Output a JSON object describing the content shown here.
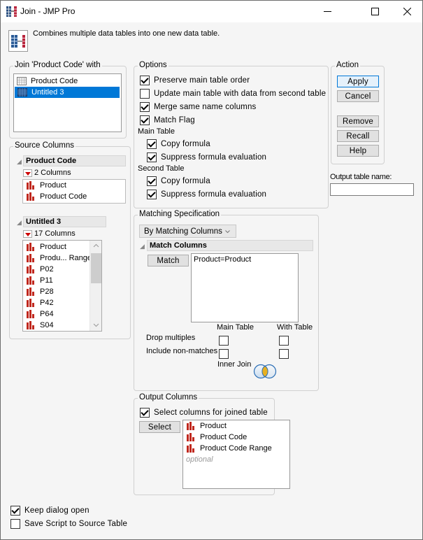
{
  "window": {
    "title": "Join - JMP Pro",
    "minimize_icon": "minimize-icon",
    "maximize_icon": "maximize-icon",
    "close_icon": "close-icon"
  },
  "header": {
    "description": "Combines multiple data tables into one new data table.",
    "app_icon": "join-tables-icon"
  },
  "join_with": {
    "label": "Join 'Product Code' with",
    "tables": [
      {
        "name": "Product Code",
        "selected": false,
        "icon": "data-table-icon"
      },
      {
        "name": "Untitled 3",
        "selected": true,
        "icon": "data-table-icon"
      }
    ]
  },
  "source_columns": {
    "label": "Source Columns",
    "tables": [
      {
        "name": "Product Code",
        "count_label": "2 Columns",
        "columns": [
          "Product",
          "Product Code"
        ]
      },
      {
        "name": "Untitled 3",
        "count_label": "17 Columns",
        "columns": [
          "Product",
          "Produ... Range",
          "P02",
          "P11",
          "P28",
          "P42",
          "P64",
          "S04"
        ]
      }
    ]
  },
  "options": {
    "label": "Options",
    "items": [
      {
        "label": "Preserve main table order",
        "checked": true
      },
      {
        "label": "Update main table with data from second table",
        "checked": false
      },
      {
        "label": "Merge same name columns",
        "checked": true
      },
      {
        "label": "Match Flag",
        "checked": true
      }
    ],
    "main_table": {
      "label": "Main Table",
      "items": [
        {
          "label": "Copy formula",
          "checked": true
        },
        {
          "label": "Suppress formula evaluation",
          "checked": true
        }
      ]
    },
    "second_table": {
      "label": "Second Table",
      "items": [
        {
          "label": "Copy formula",
          "checked": true
        },
        {
          "label": "Suppress formula evaluation",
          "checked": true
        }
      ]
    }
  },
  "action": {
    "label": "Action",
    "apply": "Apply",
    "cancel": "Cancel",
    "remove": "Remove",
    "recall": "Recall",
    "help": "Help"
  },
  "output_table": {
    "label": "Output table name:",
    "value": "",
    "placeholder": ""
  },
  "matching": {
    "label": "Matching Specification",
    "method": "By Matching Columns",
    "match_columns_label": "Match Columns",
    "match_button": "Match",
    "matches": [
      "Product=Product"
    ],
    "main_table_label": "Main Table",
    "with_table_label": "With Table",
    "drop_multiples_label": "Drop multiples",
    "include_nonmatches_label": "Include non-matches",
    "drop_multiples": {
      "main": false,
      "with": false
    },
    "include_nonmatches": {
      "main": false,
      "with": false
    },
    "join_type": "Inner Join",
    "join_icon": "venn-inner-join-icon"
  },
  "output_columns": {
    "label": "Output Columns",
    "select_for_joined": {
      "label": "Select columns for joined table",
      "checked": true
    },
    "select_button": "Select",
    "columns": [
      "Product",
      "Product Code",
      "Product Code Range"
    ],
    "optional_hint": "optional"
  },
  "footer": {
    "keep_open": {
      "label": "Keep dialog open",
      "checked": true
    },
    "save_script": {
      "label": "Save Script to Source Table",
      "checked": false
    }
  },
  "colors": {
    "selection": "#0078d7",
    "column_icon": "#c0281e",
    "venn_fill": "#e8b020",
    "venn_stroke": "#2a6db5"
  }
}
